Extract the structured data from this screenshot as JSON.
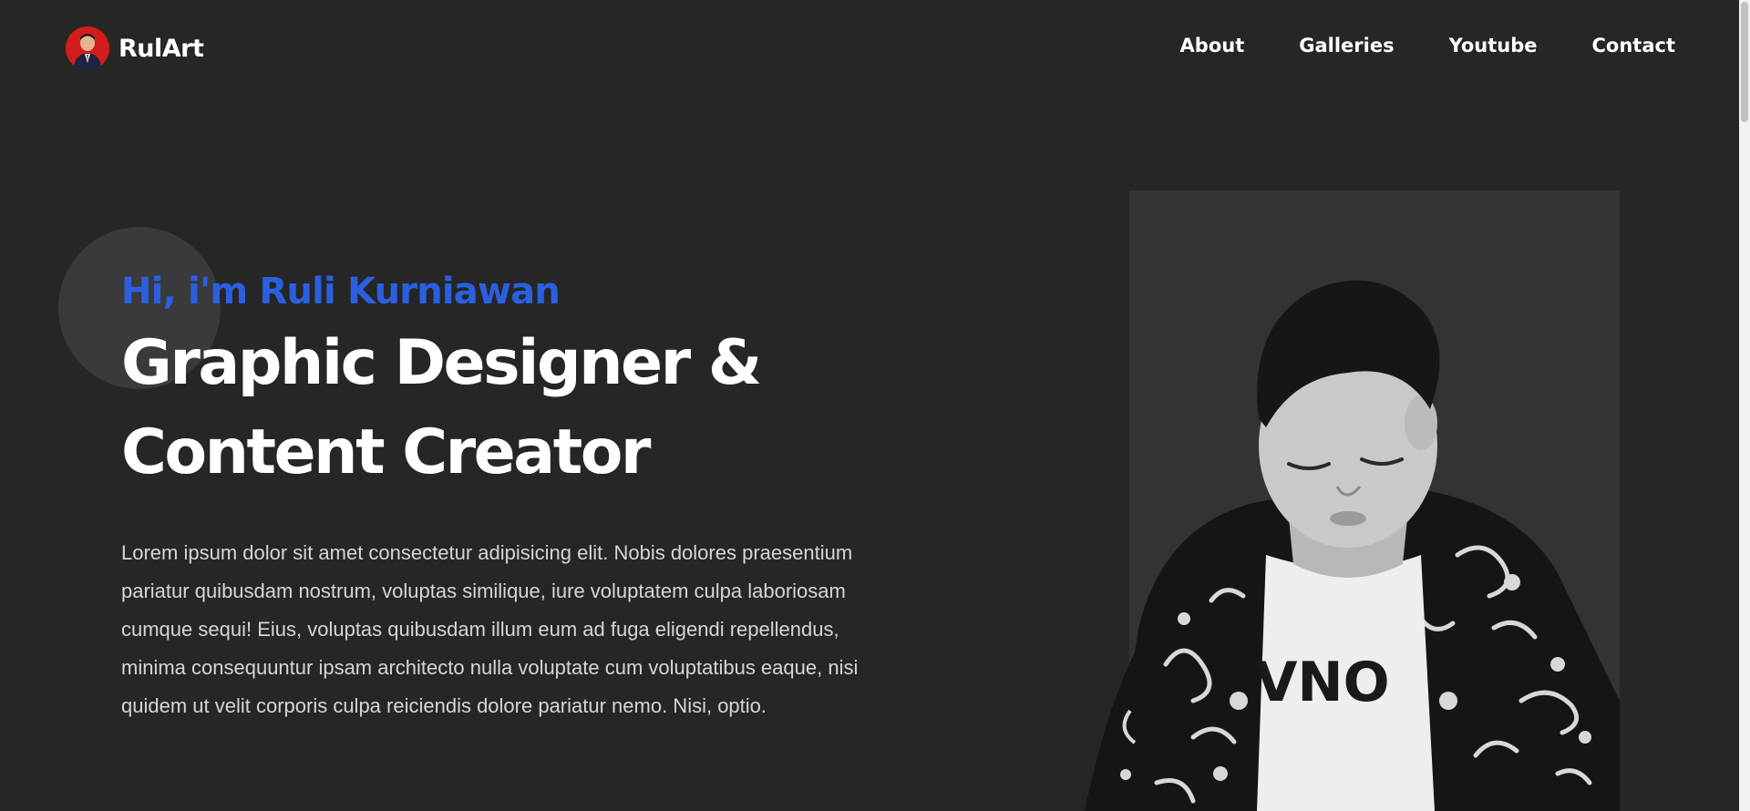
{
  "header": {
    "brand": "RulArt",
    "avatar_icon": "profile-avatar",
    "nav": [
      {
        "label": "About"
      },
      {
        "label": "Galleries"
      },
      {
        "label": "Youtube"
      },
      {
        "label": "Contact"
      }
    ]
  },
  "hero": {
    "greeting": "Hi, i'm Ruli Kurniawan",
    "title": "Graphic Designer & Content Creator",
    "description": "Lorem ipsum dolor sit amet consectetur adipisicing elit. Nobis dolores praesentium pariatur quibusdam nostrum, voluptas similique, iure voluptatem culpa laboriosam cumque sequi! Eius, voluptas quibusdam illum eum ad fuga eligendi repellendus, minima consequuntur ipsam architecto nulla voluptate cum voluptatibus eaque, nisi quidem ut velit corporis culpa reiciendis dolore pariatur nemo. Nisi, optio.",
    "photo_icon": "portrait-photo"
  },
  "colors": {
    "background": "#262627",
    "accent": "#2a60e0",
    "text": "#ffffff",
    "body_text": "#d6d6d6",
    "photo_panel": "#333334"
  }
}
